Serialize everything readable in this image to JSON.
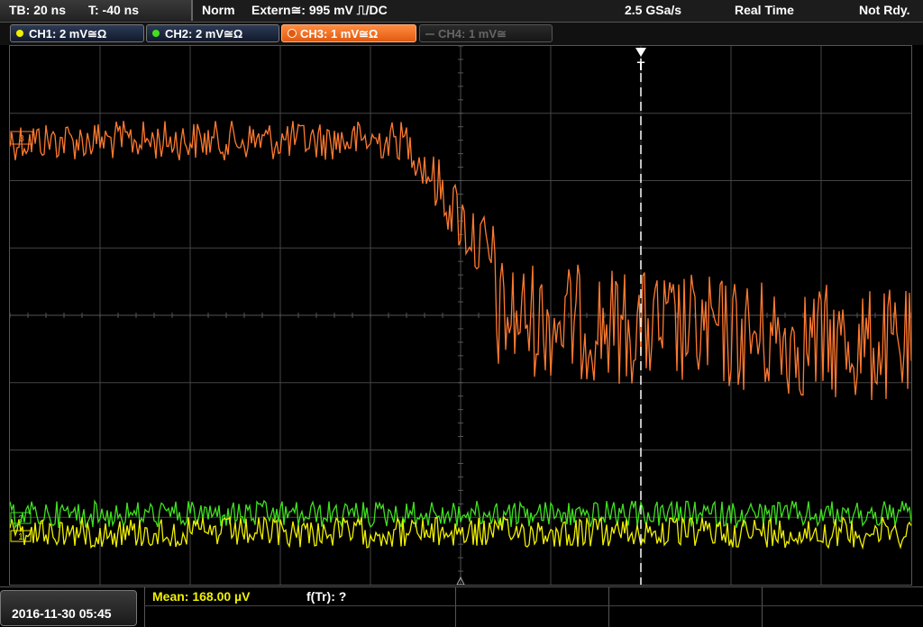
{
  "topbar": {
    "timebase": "TB: 20 ns",
    "trigger_time": "T: -40 ns",
    "mode": "Norm",
    "trigger_source": "Extern≅: 995 mV ⎍/DC",
    "sample_rate": "2.5 GSa/s",
    "acq_mode": "Real Time",
    "status": "Not Rdy."
  },
  "channels": [
    {
      "label": "CH1: 2 mV≅Ω",
      "color": "#f0f000",
      "active": true
    },
    {
      "label": "CH2: 2 mV≅Ω",
      "color": "#40e020",
      "active": true
    },
    {
      "label": "CH3: 1 mV≅Ω",
      "color": "#ff7a30",
      "active": true
    },
    {
      "label": "CH4: 1 mV≅",
      "color": "#707070",
      "active": false
    }
  ],
  "markers": {
    "trigger_marker": "T",
    "ch3_offset": "3",
    "ch2_offset": "2",
    "ch1_offset": "1"
  },
  "bottom": {
    "datetime": "2016-11-30 05:45",
    "mean": "Mean: 168.00 µV",
    "ftr": "f(Tr): ?"
  },
  "colors": {
    "ch1": "#f0f000",
    "ch2": "#40e020",
    "ch3": "#ff7a30",
    "grid": "#444444",
    "background": "#000000"
  }
}
